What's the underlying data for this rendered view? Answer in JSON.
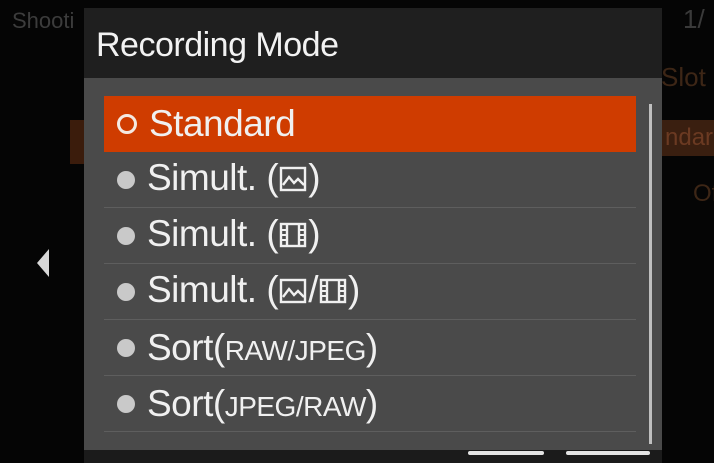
{
  "background_menu": {
    "tab_label": "Shooti",
    "page_indicator": "1/",
    "right_slot": "Slot",
    "right_standard": "ndarc",
    "right_on": "Of"
  },
  "dialog": {
    "title": "Recording Mode",
    "items": [
      {
        "label": "Standard",
        "selected": true
      },
      {
        "prefix": "Simult. (",
        "icons": [
          "photo-icon"
        ],
        "suffix": ")",
        "selected": false
      },
      {
        "prefix": "Simult. (",
        "icons": [
          "movie-icon"
        ],
        "suffix": ")",
        "selected": false
      },
      {
        "prefix": "Simult. (",
        "icons": [
          "photo-icon",
          "movie-icon"
        ],
        "separator": "/",
        "suffix": ")",
        "selected": false
      },
      {
        "prefix": "Sort(",
        "small": "RAW/JPEG",
        "suffix": ")",
        "selected": false
      },
      {
        "prefix": "Sort(",
        "small": "JPEG/RAW",
        "suffix": ")",
        "selected": false
      }
    ]
  },
  "colors": {
    "accent": "#cf3c00",
    "dialog_bg": "#4a4a4a",
    "title_bar": "#1f1f1f"
  }
}
